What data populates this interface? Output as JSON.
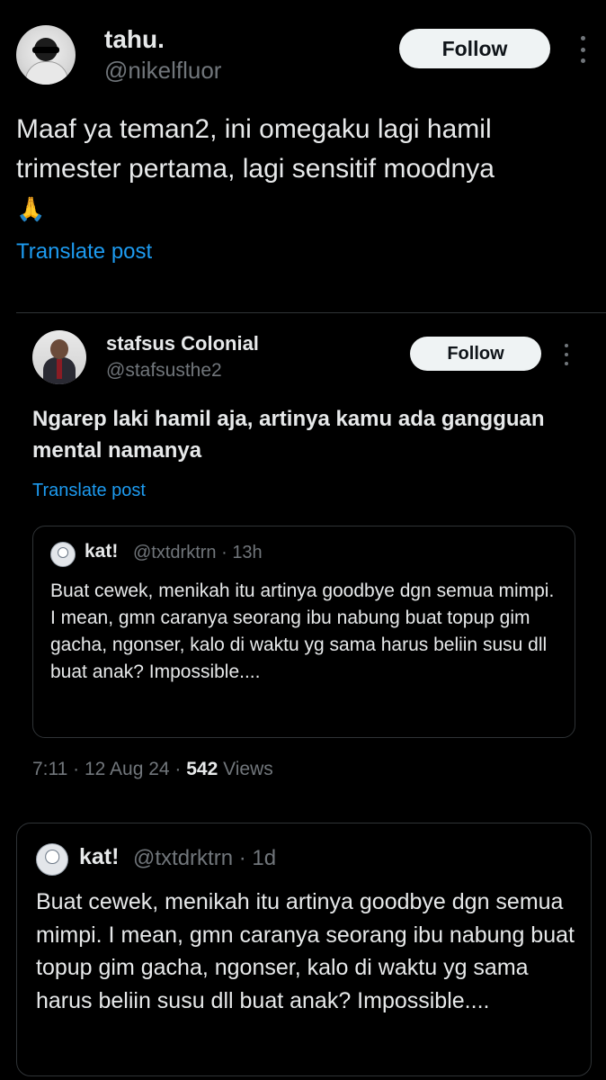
{
  "post": {
    "display_name": "tahu.",
    "handle": "@nikelfluor",
    "follow_label": "Follow",
    "text": "Maaf ya teman2, ini omegaku lagi hamil trimester pertama, lagi sensitif moodnya",
    "emoji": "🙏",
    "translate_label": "Translate post"
  },
  "quoted": {
    "display_name": "stafsus Colonial",
    "handle": "@stafsusthe2",
    "follow_label": "Follow",
    "text": "Ngarep laki hamil aja, artinya kamu ada gangguan mental namanya",
    "translate_label": "Translate post",
    "nested": {
      "display_name": "kat!",
      "handle": "@txtdrktrn · 13h",
      "text": "Buat cewek, menikah itu artinya goodbye dgn semua mimpi. I mean, gmn caranya seorang ibu nabung buat topup gim gacha, ngonser, kalo di waktu yg sama harus beliin susu dll buat anak? Impossible...."
    },
    "meta": {
      "time": "7:11 · 12 Aug 24 · ",
      "views_count": "542",
      "views_label": " Views"
    }
  },
  "bottom_quote": {
    "display_name": "kat!",
    "handle": "@txtdrktrn · 1d",
    "text": "Buat cewek, menikah itu artinya goodbye dgn semua mimpi. I mean, gmn caranya seorang ibu nabung buat topup gim gacha, ngonser, kalo di waktu yg sama harus beliin susu dll buat anak? Impossible...."
  },
  "colors": {
    "background": "#000000",
    "text": "#e7e9ea",
    "secondary_text": "#71767b",
    "link": "#1d9bf0",
    "button_bg": "#eff3f4",
    "border": "#2f3336"
  }
}
